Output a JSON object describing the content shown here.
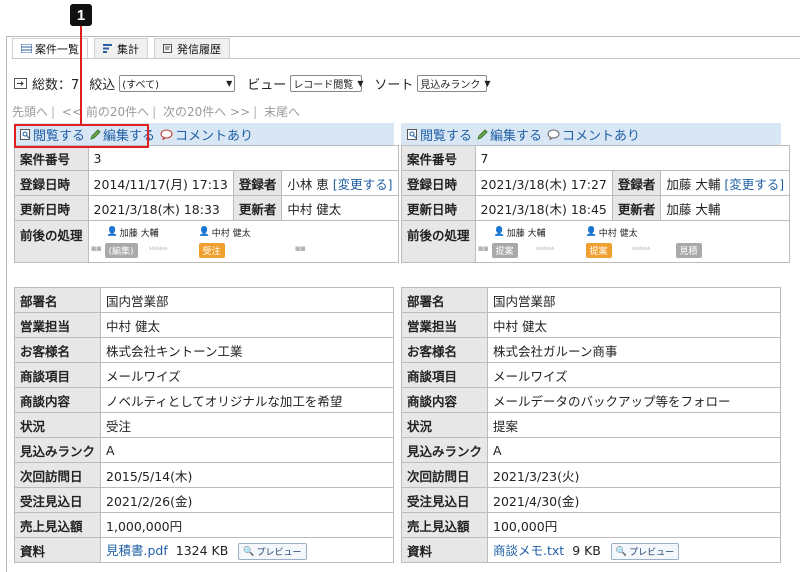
{
  "callout": "1",
  "tabs": [
    {
      "label": "案件一覧",
      "icon": "list-icon",
      "active": true
    },
    {
      "label": "集計",
      "icon": "chart-icon",
      "active": false
    },
    {
      "label": "発信履歴",
      "icon": "history-icon",
      "active": false
    }
  ],
  "toolbar": {
    "total_label": "総数：7",
    "filter_label": "絞込",
    "filter_value": "(すべて)",
    "view_label": "ビュー",
    "view_value": "レコード閲覧",
    "sort_label": "ソート",
    "sort_value": "見込みランク"
  },
  "pager": {
    "first": "先頭へ",
    "prev": "<< 前の20件へ",
    "next": "次の20件へ >>",
    "last": "末尾へ"
  },
  "field_labels": {
    "case_no": "案件番号",
    "registered": "登録日時",
    "registrant": "登録者",
    "updated": "更新日時",
    "updater": "更新者",
    "process": "前後の処理",
    "dept": "部署名",
    "rep": "営業担当",
    "customer": "お客様名",
    "item": "商談項目",
    "content": "商談内容",
    "status": "状況",
    "rank": "見込みランク",
    "next_visit": "次回訪問日",
    "order_date": "受注見込日",
    "sales": "売上見込額",
    "material": "資料"
  },
  "actions": {
    "view": "閲覧する",
    "edit": "編集する",
    "comment": "コメントあり"
  },
  "change_link": "[変更する]",
  "preview_label": "プレビュー",
  "records": [
    {
      "case_no": "3",
      "registered": "2014/11/17(月) 17:13",
      "registrant": "小林 恵",
      "updated": "2021/3/18(木) 18:33",
      "updater": "中村 健太",
      "proc_person1": "加藤 大輔",
      "proc_person2": "中村 健太",
      "proc_prev": "(編集)",
      "proc_current": "受注",
      "proc_next": "",
      "dept": "国内営業部",
      "rep": "中村 健太",
      "customer": "株式会社キントーン工業",
      "item": "メールワイズ",
      "content": "ノベルティとしてオリジナルな加工を希望",
      "status": "受注",
      "rank": "A",
      "next_visit": "2015/5/14(木)",
      "order_date": "2021/2/26(金)",
      "sales": "1,000,000円",
      "file": "見積書.pdf",
      "file_size": "1324 KB"
    },
    {
      "case_no": "7",
      "registered": "2021/3/18(木) 17:27",
      "registrant": "加藤 大輔",
      "updated": "2021/3/18(木) 18:45",
      "updater": "加藤 大輔",
      "proc_person1": "加藤 大輔",
      "proc_person2": "中村 健太",
      "proc_prev": "提案",
      "proc_current": "提案",
      "proc_next": "見積",
      "dept": "国内営業部",
      "rep": "中村 健太",
      "customer": "株式会社ガルーン商事",
      "item": "メールワイズ",
      "content": "メールデータのバックアップ等をフォロー",
      "status": "提案",
      "rank": "A",
      "next_visit": "2021/3/23(火)",
      "order_date": "2021/4/30(金)",
      "sales": "100,000円",
      "file": "商談メモ.txt",
      "file_size": "9 KB"
    }
  ],
  "colors": {
    "accent": "#1f5fa6",
    "highlight": "#e02020",
    "action_bar": "#d9e7f4",
    "status_orange": "#f0a030"
  }
}
